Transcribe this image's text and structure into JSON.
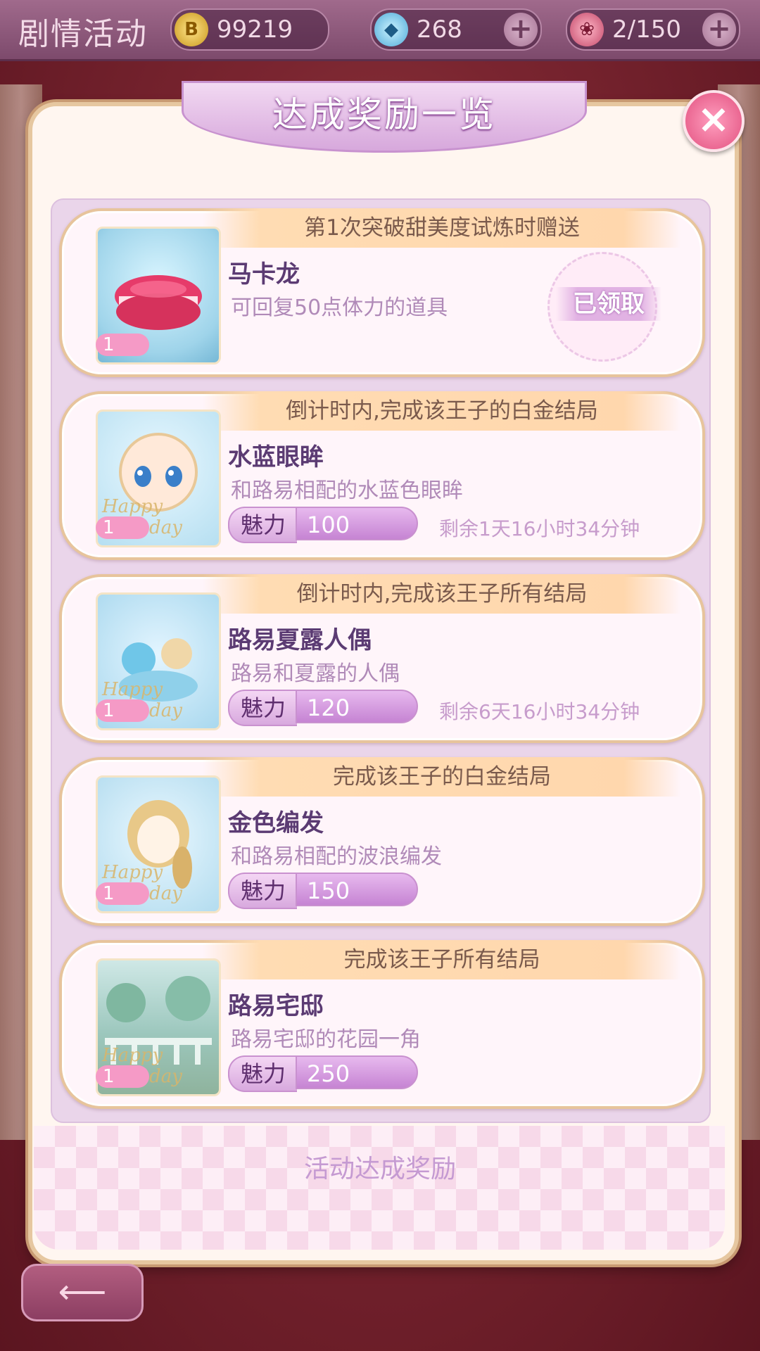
{
  "topbar": {
    "title": "剧情活动",
    "coins": "99219",
    "gems": "268",
    "roses": "2/150"
  },
  "icons": {
    "coin": "coin-icon",
    "gem": "diamond-icon",
    "rose": "rose-icon",
    "close": "close-icon",
    "back": "back-arrow-icon"
  },
  "modal": {
    "title": "达成奖励一览",
    "footer": "活动达成奖励"
  },
  "rewards": [
    {
      "condition": "第1次突破甜美度试炼时赠送",
      "name": "马卡龙",
      "description": "可回复50点体力的道具",
      "quantity": "1",
      "status": "已领取"
    },
    {
      "condition": "倒计时内,完成该王子的白金结局",
      "name": "水蓝眼眸",
      "description": "和路易相配的水蓝色眼眸",
      "quantity": "1",
      "charm_label": "魅力",
      "charm": "100",
      "timer": "剩余1天16小时34分钟"
    },
    {
      "condition": "倒计时内,完成该王子所有结局",
      "name": "路易夏露人偶",
      "description": "路易和夏露的人偶",
      "quantity": "1",
      "charm_label": "魅力",
      "charm": "120",
      "timer": "剩余6天16小时34分钟"
    },
    {
      "condition": "完成该王子的白金结局",
      "name": "金色编发",
      "description": "和路易相配的波浪编发",
      "quantity": "1",
      "charm_label": "魅力",
      "charm": "150"
    },
    {
      "condition": "完成该王子所有结局",
      "name": "路易宅邸",
      "description": "路易宅邸的花园一角",
      "quantity": "1",
      "charm_label": "魅力",
      "charm": "250"
    }
  ],
  "thumbnail_overlay": "Happy Birthday",
  "colors": {
    "accent_purple": "#c684d3",
    "condition_band": "#ffd7ad",
    "card_border": "#e7c49c",
    "close_pink": "#e2507f"
  }
}
